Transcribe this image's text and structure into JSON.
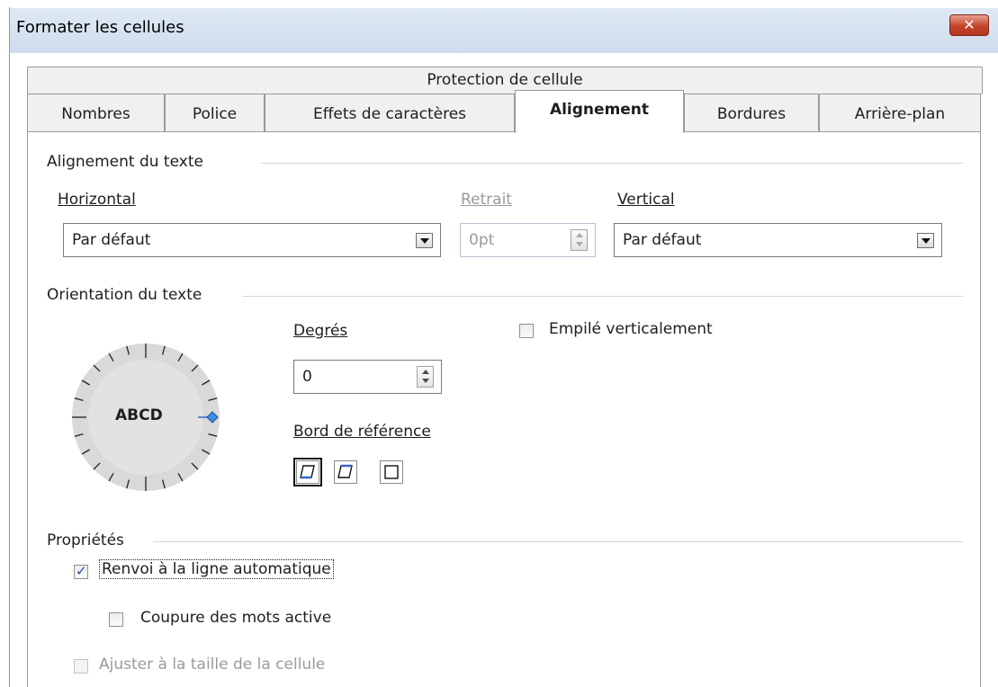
{
  "window": {
    "title": "Formater les cellules"
  },
  "tabs": {
    "row1": "Protection de cellule",
    "row2": [
      "Nombres",
      "Police",
      "Effets de caractères",
      "Alignement",
      "Bordures",
      "Arrière-plan"
    ],
    "active": "Alignement"
  },
  "text_alignment": {
    "section_label": "Alignement du texte",
    "horizontal_label": "Horizontal",
    "horizontal_value": "Par défaut",
    "indent_label": "Retrait",
    "indent_value": "0pt",
    "vertical_label": "Vertical",
    "vertical_value": "Par défaut"
  },
  "orientation": {
    "section_label": "Orientation du texte",
    "dial_text": "ABCD",
    "degrees_label": "Degrés",
    "degrees_value": "0",
    "reference_edge_label": "Bord de référence",
    "stacked_label": "Empilé verticalement",
    "stacked_checked": false
  },
  "properties": {
    "section_label": "Propriétés",
    "wrap_label": "Renvoi à la ligne automatique",
    "wrap_checked": true,
    "hyphenation_label": "Coupure des mots active",
    "hyphenation_checked": false,
    "shrink_label": "Ajuster à la taille de la cellule",
    "shrink_checked": false,
    "shrink_enabled": false
  },
  "colors": {
    "accent_blue": "#3465c8",
    "close_red": "#c4442a",
    "title_bar": "#d6e2f0"
  }
}
